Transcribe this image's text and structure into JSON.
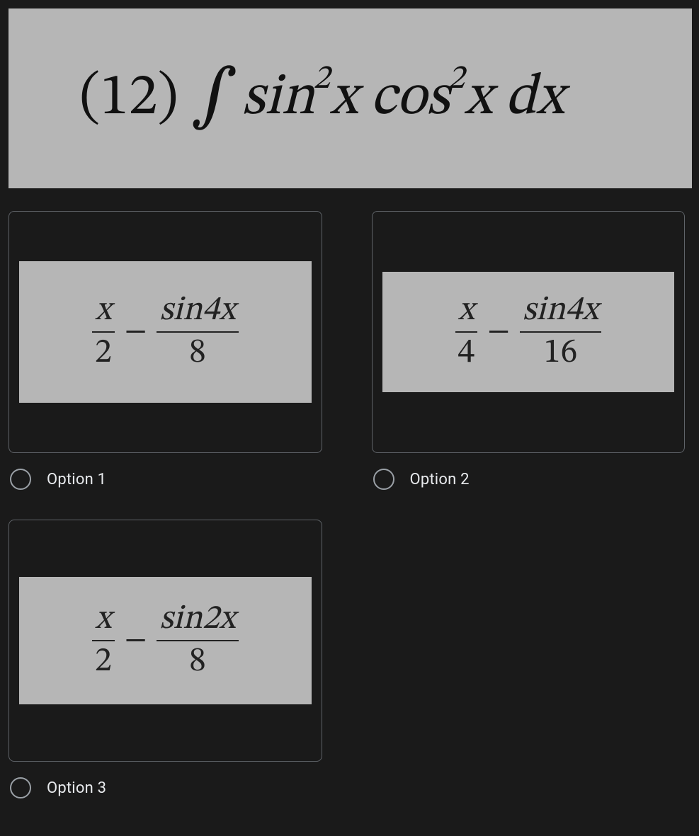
{
  "question": {
    "number_open": "(",
    "number": "12",
    "number_close": ")",
    "integral_symbol": "∫",
    "term_sin": "sin",
    "exp2a": "2",
    "x1": "x",
    "term_cos": "cos",
    "exp2b": "2",
    "x2": "x",
    "dx": "dx"
  },
  "options": [
    {
      "label": "Option 1",
      "frac1": {
        "num": "x",
        "den": "2"
      },
      "minus": "−",
      "frac2": {
        "num": "sin4x",
        "den": "8"
      }
    },
    {
      "label": "Option 2",
      "frac1": {
        "num": "x",
        "den": "4"
      },
      "minus": "−",
      "frac2": {
        "num": "sin4x",
        "den": "16"
      }
    },
    {
      "label": "Option 3",
      "frac1": {
        "num": "x",
        "den": "2"
      },
      "minus": "−",
      "frac2": {
        "num": "sin2x",
        "den": "8"
      }
    }
  ]
}
